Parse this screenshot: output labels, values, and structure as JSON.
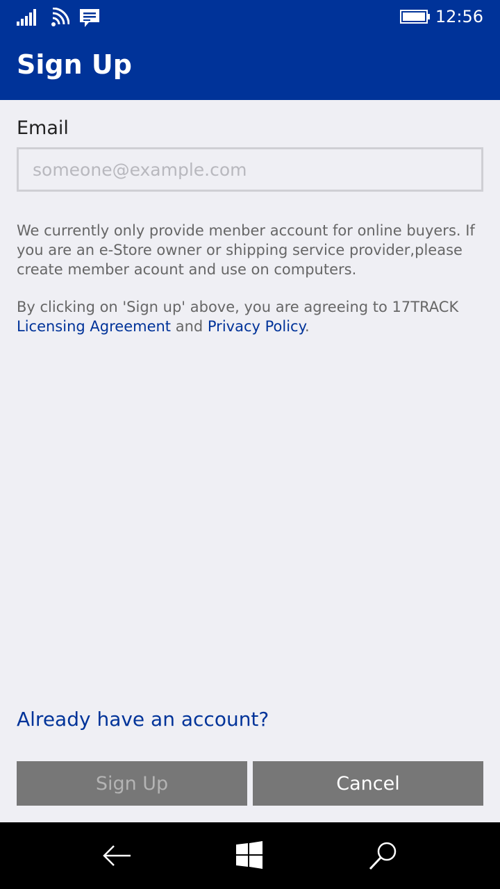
{
  "status_bar": {
    "time": "12:56",
    "icons": [
      "signal-icon",
      "wifi-icon",
      "message-icon",
      "battery-icon"
    ]
  },
  "header": {
    "title": "Sign Up"
  },
  "form": {
    "email_label": "Email",
    "email_value": "",
    "email_placeholder": "someone@example.com"
  },
  "info": {
    "text": "We currently only provide menber account for online buyers. If you are an e-Store owner or shipping service provider,please create member acount and use on computers."
  },
  "agreement": {
    "prefix": "By clicking on 'Sign up' above, you are agreeing to 17TRACK ",
    "licensing_link": "Licensing Agreement",
    "middle": " and ",
    "privacy_link": "Privacy Policy",
    "suffix": "."
  },
  "account_link": "Already have an account?",
  "buttons": {
    "signup": "Sign Up",
    "cancel": "Cancel"
  },
  "nav": {
    "icons": [
      "back-arrow-icon",
      "windows-logo-icon",
      "search-icon"
    ]
  },
  "colors": {
    "accent": "#003399",
    "background": "#efeff4",
    "button": "#777777"
  }
}
